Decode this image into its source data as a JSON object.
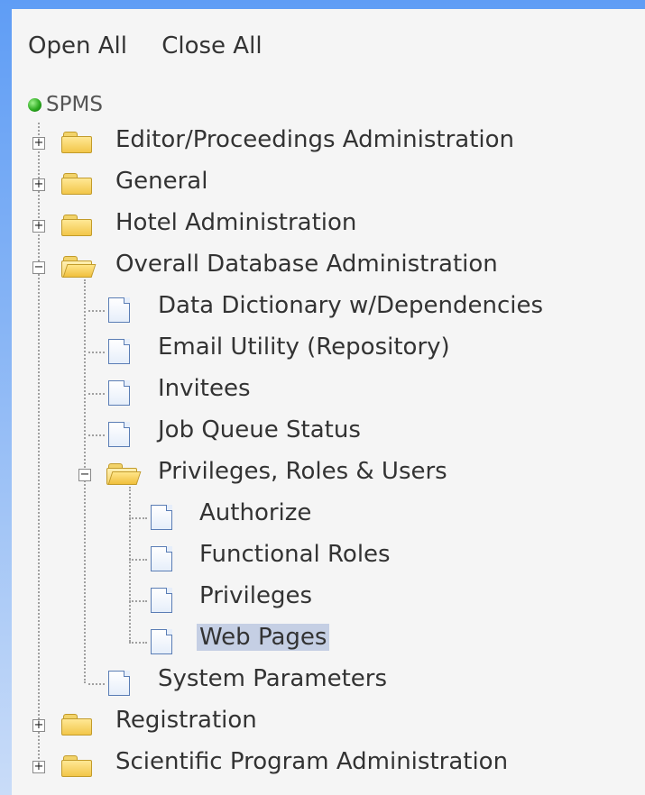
{
  "toplinks": {
    "open_all": "Open All",
    "close_all": "Close All"
  },
  "tree": {
    "root": "SPMS",
    "editor": "Editor/Proceedings Administration",
    "general": "General",
    "hotel": "Hotel Administration",
    "overall": "Overall Database Administration",
    "data_dict": "Data Dictionary w/Dependencies",
    "email": "Email Utility (Repository)",
    "invitees": "Invitees",
    "job_queue": "Job Queue Status",
    "privs_roles": "Privileges, Roles & Users",
    "authorize": "Authorize",
    "func_roles": "Functional Roles",
    "privileges": "Privileges",
    "web_pages": "Web Pages",
    "sys_params": "System Parameters",
    "registration": "Registration",
    "scientific": "Scientific Program Administration"
  },
  "toggles": {
    "plus": "+",
    "minus": "−"
  },
  "colors": {
    "selected_bg": "#c5cfe4",
    "folder": "#f2c64a",
    "root_ball": "#2dab20"
  }
}
